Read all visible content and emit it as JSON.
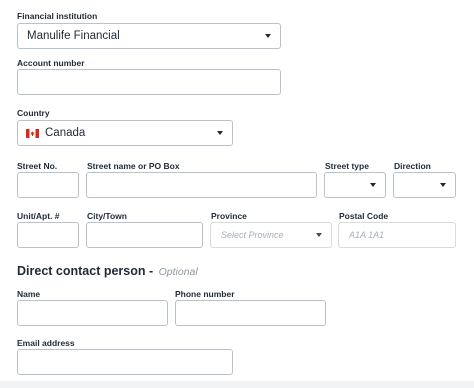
{
  "financial_institution": {
    "label": "Financial institution",
    "value": "Manulife Financial"
  },
  "account_number": {
    "label": "Account number",
    "value": ""
  },
  "country": {
    "label": "Country",
    "value": "Canada",
    "flag_icon": "canada-flag-icon"
  },
  "street_no": {
    "label": "Street No.",
    "value": ""
  },
  "street_name": {
    "label": "Street name or PO Box",
    "value": ""
  },
  "street_type": {
    "label": "Street type",
    "value": ""
  },
  "direction": {
    "label": "Direction",
    "value": ""
  },
  "unit": {
    "label": "Unit/Apt. #",
    "value": ""
  },
  "city": {
    "label": "City/Town",
    "value": ""
  },
  "province": {
    "label": "Province",
    "placeholder": "Select Province"
  },
  "postal_code": {
    "label": "Postal Code",
    "placeholder": "A1A 1A1"
  },
  "contact_section": {
    "title": "Direct contact person",
    "separator": " - ",
    "optional": "Optional"
  },
  "contact_name": {
    "label": "Name",
    "value": ""
  },
  "phone_number": {
    "label": "Phone number",
    "value": ""
  },
  "email_address": {
    "label": "Email address",
    "value": ""
  },
  "colors": {
    "text": "#1f2a37",
    "border": "#b9c2cc",
    "placeholder": "#a7afb8",
    "flag_red": "#d52b1e"
  }
}
